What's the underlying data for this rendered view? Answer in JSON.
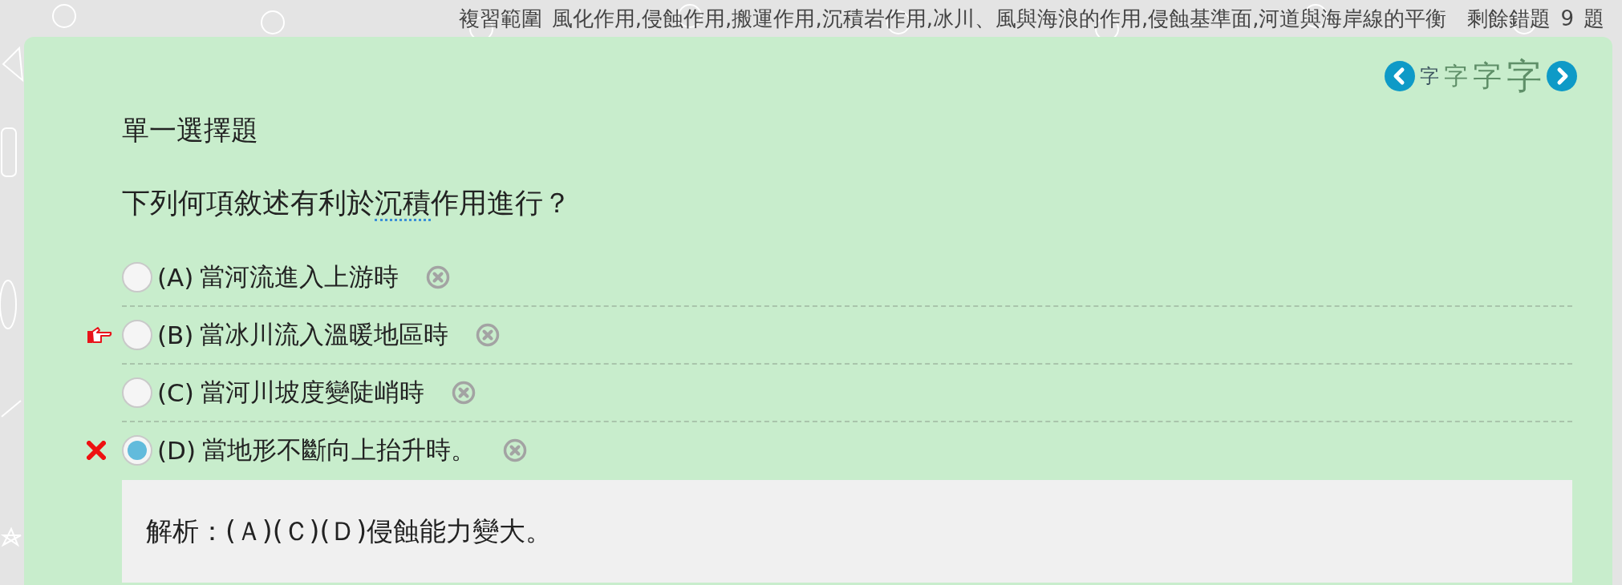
{
  "header": {
    "scope_label": "複習範圍",
    "scope_text": "風化作用,侵蝕作用,搬運作用,沉積岩作用,冰川、風與海浪的作用,侵蝕基準面,河道與海岸線的平衡",
    "remaining_label": "剩餘錯題",
    "remaining_count": "9",
    "remaining_unit": "題"
  },
  "font_sizes": [
    {
      "label": "字",
      "selected": true
    },
    {
      "label": "字",
      "selected": false
    },
    {
      "label": "字",
      "selected": false
    },
    {
      "label": "字",
      "selected": false
    }
  ],
  "question_type": "單一選擇題",
  "question": {
    "before": "下列何項敘述有利於",
    "term": "沉積",
    "after": "作用進行？"
  },
  "options": [
    {
      "letter": "(A)",
      "text": "當河流進入上游時",
      "selected": false,
      "hinted": false,
      "wrong": false
    },
    {
      "letter": "(B)",
      "text": "當冰川流入溫暖地區時",
      "selected": false,
      "hinted": true,
      "wrong": false
    },
    {
      "letter": "(C)",
      "text": "當河川坡度變陡峭時",
      "selected": false,
      "hinted": false,
      "wrong": false
    },
    {
      "letter": "(D)",
      "text": "當地形不斷向上抬升時。",
      "selected": true,
      "hinted": false,
      "wrong": true
    }
  ],
  "explanation": "解析：(Ａ)(Ｃ)(Ｄ)侵蝕能力變大。"
}
